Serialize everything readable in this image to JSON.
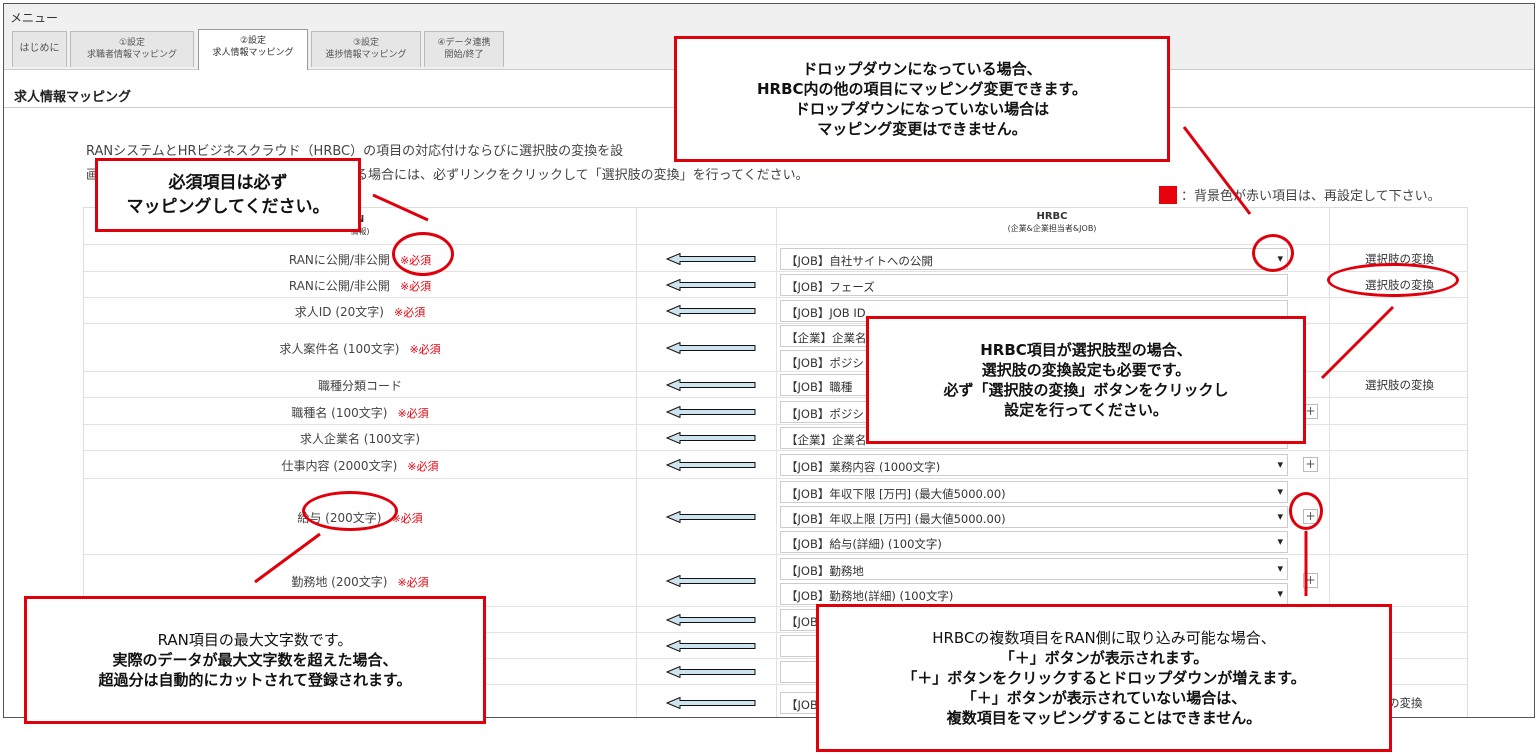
{
  "menu": {
    "label": "メニュー"
  },
  "tabs": [
    {
      "line1": "はじめに",
      "line2": ""
    },
    {
      "line1": "①設定",
      "line2": "求職者情報マッピング"
    },
    {
      "line1": "②設定",
      "line2": "求人情報マッピング"
    },
    {
      "line1": "③設定",
      "line2": "進捗情報マッピング"
    },
    {
      "line1": "④データ連携",
      "line2": "開始/終了"
    }
  ],
  "section_title": "求人情報マッピング",
  "description": {
    "line1": "RANシステムとHRビジネスクラウド（HRBC）の項目の対応付けならびに選択肢の変換を設",
    "line2": "画",
    "line2b": "ている場合には、必ずリンクをクリックして「選択肢の変換」を行ってください。"
  },
  "legend": {
    "text": "：背景色が赤い項目は、再設定して下さい。",
    "color": "#e8000d"
  },
  "table": {
    "ran_header": "N",
    "ran_subheader": "情報)",
    "hrbc_header": "HRBC",
    "hrbc_subheader": "(企業&企業担当者&JOB)",
    "required_label": "※必須",
    "convert_label": "選択肢の変換",
    "plus_label": "+",
    "rows": [
      {
        "ran": "RANに公開/非公開",
        "required": true,
        "fields": [
          "【JOB】自社サイトへの公開"
        ],
        "convert": true
      },
      {
        "ran": "RANに公開/非公開",
        "required": true,
        "fields": [
          "【JOB】フェーズ"
        ],
        "convert": true
      },
      {
        "ran": "求人ID (20文字)",
        "required": true,
        "fields": [
          "【JOB】JOB ID"
        ],
        "convert": false
      },
      {
        "ran": "求人案件名 (100文字)",
        "required": true,
        "fields": [
          "【企業】企業名",
          "【JOB】ポジシ"
        ],
        "convert": false
      },
      {
        "ran": "職種分類コード",
        "required": false,
        "fields": [
          "【JOB】職種"
        ],
        "convert": true
      },
      {
        "ran": "職種名 (100文字)",
        "required": true,
        "fields": [
          "【JOB】ポジシ"
        ],
        "convert": false
      },
      {
        "ran": "求人企業名 (100文字)",
        "required": false,
        "fields": [
          "【企業】企業名"
        ],
        "convert": false
      },
      {
        "ran": "仕事内容 (2000文字)",
        "required": true,
        "fields": [
          "【JOB】業務内容 (1000文字)"
        ],
        "convert": false
      },
      {
        "ran": "給与 (200文字)",
        "required": true,
        "fields": [
          "【JOB】年収下限 [万円] (最大値5000.00)",
          "【JOB】年収上限 [万円] (最大値5000.00)",
          "【JOB】給与(詳細) (100文字)"
        ],
        "convert": false
      },
      {
        "ran": "勤務地 (200文字)",
        "required": true,
        "fields": [
          "【JOB】勤務地",
          "【JOB】勤務地(詳細) (100文字)"
        ],
        "convert": false
      },
      {
        "ran": "",
        "required": false,
        "fields": [
          "【JOB"
        ],
        "convert": false
      },
      {
        "ran": "",
        "required": false,
        "fields": [
          ""
        ],
        "convert": false
      },
      {
        "ran": "",
        "required": false,
        "fields": [
          ""
        ],
        "convert": false
      },
      {
        "ran": "",
        "required": false,
        "fields": [
          "【JOB"
        ],
        "convert": true,
        "convert_text": "肢の変換"
      }
    ]
  },
  "callouts": {
    "dropdown": [
      "ドロップダウンになっている場合、",
      "HRBC内の他の項目にマッピング変更できます。",
      "ドロップダウンになっていない場合は",
      "マッピング変更はできません。"
    ],
    "required": [
      "必須項目は必ず",
      "マッピングしてください。"
    ],
    "convert": [
      "HRBC項目が選択肢型の場合、",
      "選択肢の変換設定も必要です。",
      "必ず「選択肢の変換」ボタンをクリックし",
      "設定を行ってください。"
    ],
    "maxlen": [
      "RAN項目の最大文字数です。",
      "実際のデータが最大文字数を超えた場合、",
      "超過分は自動的にカットされて登録されます。"
    ],
    "plus": [
      "HRBCの複数項目をRAN側に取り込み可能な場合、",
      "「＋」ボタンが表示されます。",
      "「＋」ボタンをクリックするとドロップダウンが増えます。",
      "「＋」ボタンが表示されていない場合は、",
      "複数項目をマッピングすることはできません。"
    ]
  },
  "colors": {
    "accent_red": "#e0000b",
    "arrow_fill": "#cde3ef"
  }
}
